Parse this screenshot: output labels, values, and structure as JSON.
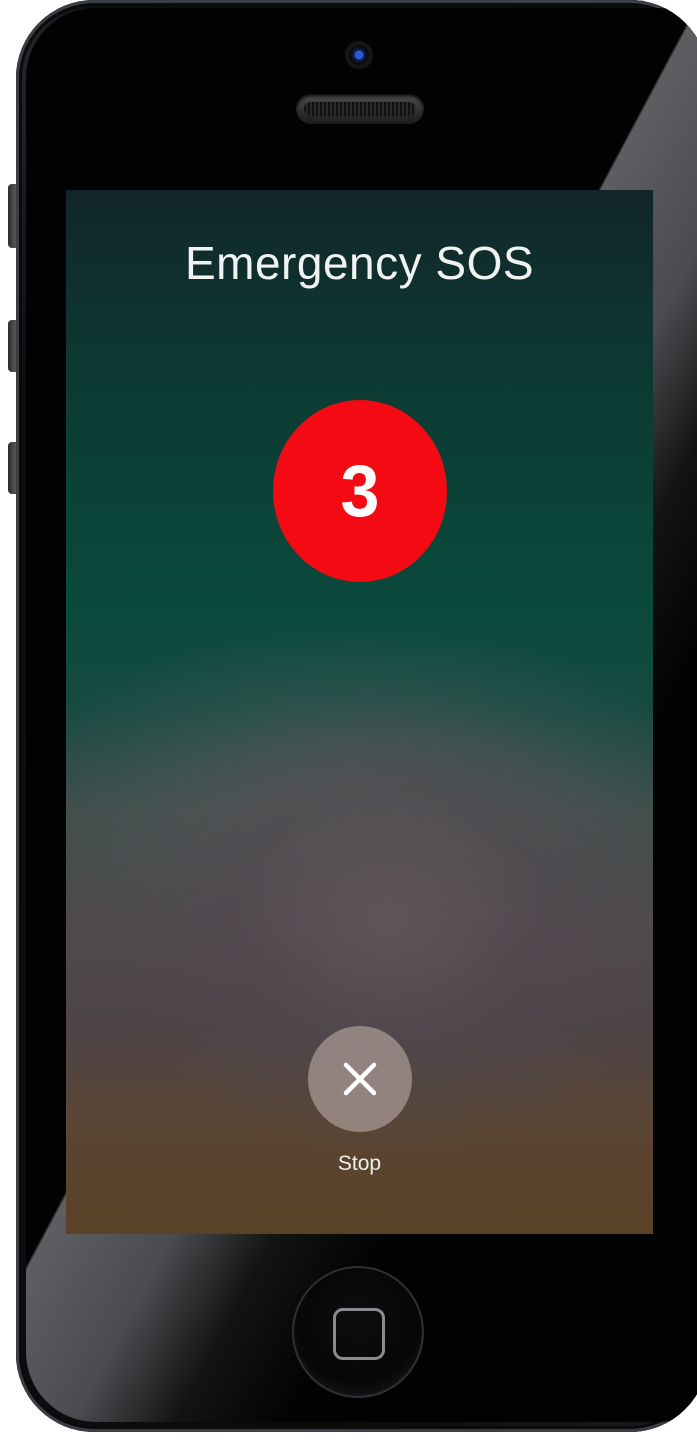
{
  "screen": {
    "title": "Emergency SOS",
    "countdown": "3",
    "stop_label": "Stop"
  },
  "icons": {
    "stop": "close-x-icon",
    "home": "home-square-icon"
  },
  "colors": {
    "countdown_red": "#f40a12",
    "title_text": "#f1f3f3",
    "stop_button_fill": "#aa9b96"
  }
}
